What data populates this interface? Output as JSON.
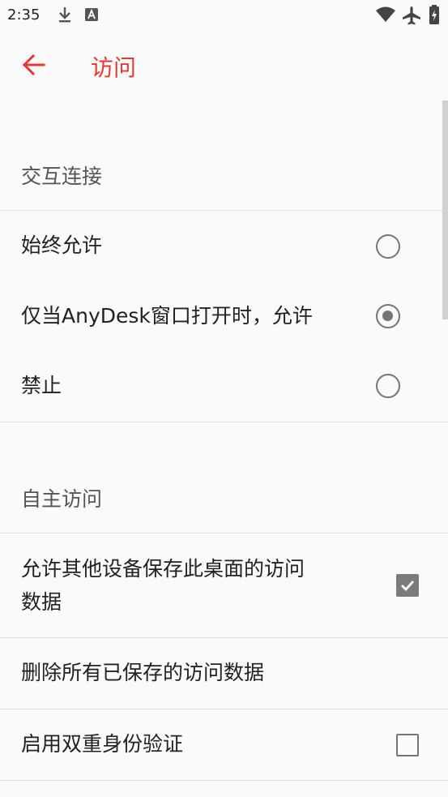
{
  "status_bar": {
    "time": "2:35",
    "left_icons": [
      "download-icon",
      "a-notification-icon"
    ],
    "right_icons": [
      "wifi-icon",
      "airplane-icon",
      "battery-charging-icon"
    ]
  },
  "app_bar": {
    "title": "访问",
    "back_icon": "arrow-left-icon",
    "accent_color": "#e53935"
  },
  "sections": [
    {
      "title": "交互连接",
      "options": [
        {
          "label": "始终允许",
          "control": "radio",
          "checked": false
        },
        {
          "label": "仅当AnyDesk窗口打开时，允许",
          "control": "radio",
          "checked": true
        },
        {
          "label": "禁止",
          "control": "radio",
          "checked": false
        }
      ]
    },
    {
      "title": "自主访问",
      "items": [
        {
          "label_line1": "允许其他设备保存此桌面的访问",
          "label_line2": "数据",
          "control": "checkbox",
          "checked": true
        },
        {
          "label": "删除所有已保存的访问数据"
        },
        {
          "label": "启用双重身份验证",
          "control": "checkbox",
          "checked": false
        }
      ]
    }
  ]
}
